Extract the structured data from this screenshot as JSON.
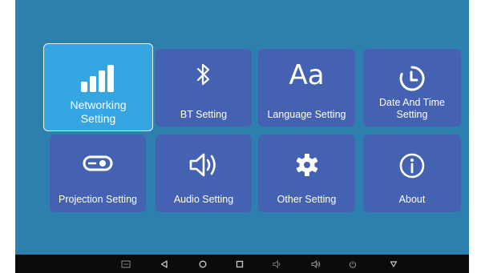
{
  "tiles": [
    {
      "label": "Networking\nSetting",
      "icon": "signal-bars-icon",
      "selected": true
    },
    {
      "label": "BT Setting",
      "icon": "bluetooth-icon"
    },
    {
      "label": "Language Setting",
      "icon": "font-aa-icon",
      "glyph": "Aa"
    },
    {
      "label": "Date And Time\nSetting",
      "icon": "clock-icon"
    },
    {
      "label": "Projection Setting",
      "icon": "projector-icon"
    },
    {
      "label": "Audio Setting",
      "icon": "speaker-icon"
    },
    {
      "label": "Other Setting",
      "icon": "gear-icon"
    },
    {
      "label": "About",
      "icon": "info-icon"
    }
  ],
  "navbar": {
    "buttons": [
      "screenshot-icon",
      "back-icon",
      "home-icon",
      "recents-icon",
      "volume-down-icon",
      "volume-up-icon",
      "power-icon",
      "hide-navbar-icon"
    ]
  },
  "colors": {
    "background": "#2d7fae",
    "tile": "#4462b1",
    "tile_selected": "#36a6e3",
    "navbar": "#0b0b0b"
  }
}
